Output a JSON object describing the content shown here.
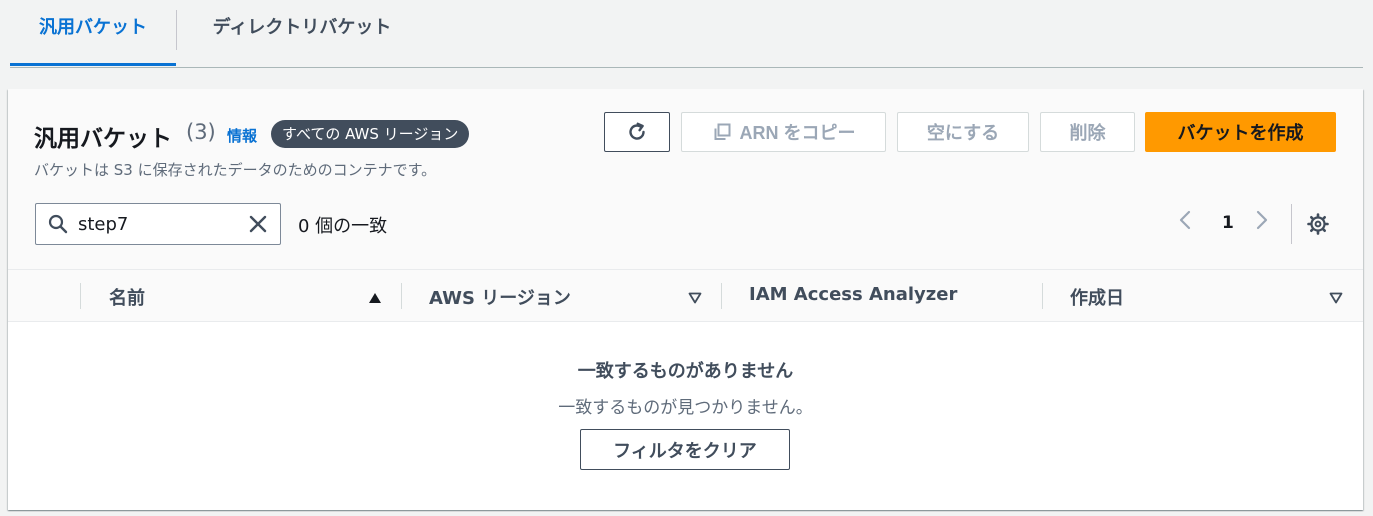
{
  "tabs": [
    {
      "label": "汎用バケット",
      "active": true
    },
    {
      "label": "ディレクトリバケット",
      "active": false
    }
  ],
  "header": {
    "title": "汎用バケット",
    "count": "(3)",
    "info_link": "情報",
    "region_badge": "すべての AWS リージョン",
    "description": "バケットは S3 に保存されたデータのためのコンテナです。"
  },
  "actions": {
    "copy_arn": "ARN をコピー",
    "empty": "空にする",
    "delete": "削除",
    "create": "バケットを作成"
  },
  "search": {
    "value": "step7",
    "placeholder": "",
    "match_count": "0 個の一致"
  },
  "pagination": {
    "current_page": "1"
  },
  "table": {
    "columns": [
      "名前",
      "AWS リージョン",
      "IAM Access Analyzer",
      "作成日"
    ]
  },
  "empty_state": {
    "title": "一致するものがありません",
    "subtitle": "一致するものが見つかりません。",
    "clear_filter": "フィルタをクリア"
  },
  "colors": {
    "accent": "#0972d3",
    "primary_button": "#ff9900",
    "badge_bg": "#414d5c"
  }
}
